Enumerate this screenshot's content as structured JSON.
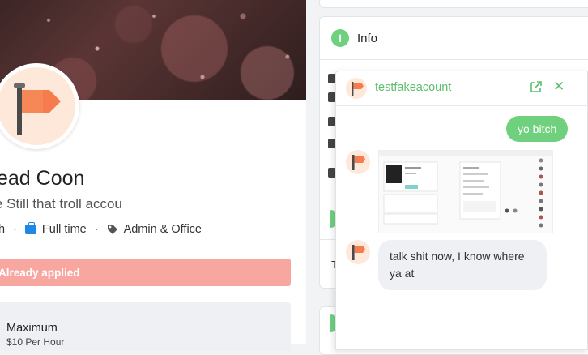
{
  "profile": {
    "name": "ead Coon",
    "tagline": "e Still that troll accou",
    "meta_prefix": "h",
    "employment": "Full time",
    "category": "Admin & Office",
    "applied_label": "Already applied",
    "salary_label": "Maximum",
    "salary_value": "$10 Per Hour"
  },
  "info": {
    "title": "Info",
    "peek_text": "T"
  },
  "chat": {
    "title": "testfakeacount",
    "messages": [
      {
        "from": "me",
        "text": "yo bitch"
      },
      {
        "from": "them",
        "type": "image"
      },
      {
        "from": "them",
        "text": "talk shit now, I know where ya at"
      }
    ]
  },
  "colors": {
    "accent_green": "#6fd17e",
    "applied_red": "#f7a6a0",
    "flag_orange": "#f47c4d",
    "briefcase_blue": "#1e88e5"
  },
  "icons": {
    "flag": "flag-icon",
    "briefcase": "briefcase-icon",
    "tag": "tag-icon",
    "info": "info-icon",
    "open": "external-link-icon",
    "close": "close-icon"
  }
}
